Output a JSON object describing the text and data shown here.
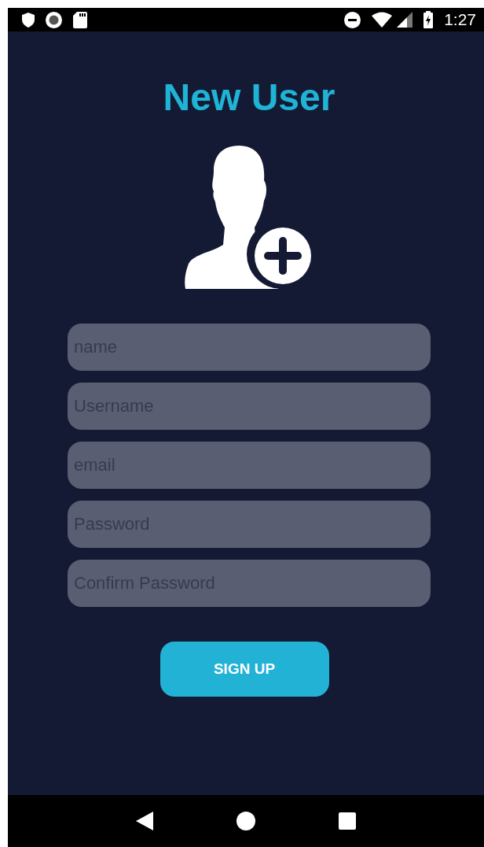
{
  "status_bar": {
    "time": "1:27"
  },
  "title": "New User",
  "fields": [
    {
      "placeholder": "name"
    },
    {
      "placeholder": "Username"
    },
    {
      "placeholder": "email"
    },
    {
      "placeholder": "Password"
    },
    {
      "placeholder": "Confirm Password"
    }
  ],
  "button": "SIGN UP"
}
